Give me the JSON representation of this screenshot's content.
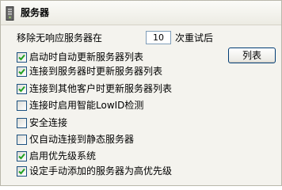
{
  "header": {
    "title": "服务器",
    "icon": "server-icon"
  },
  "retry": {
    "label": "移除无响应服务器在",
    "value": "10",
    "suffix": "次重试后"
  },
  "list_button": {
    "label": "列表"
  },
  "options": [
    {
      "label": "启动时自动更新服务器列表",
      "checked": true
    },
    {
      "label": "连接到服务器时更新服务器列表",
      "checked": true
    },
    {
      "label": "连接到其他客户时更新服务器列表",
      "checked": true
    },
    {
      "label": "连接时启用智能LowID检测",
      "checked": false
    },
    {
      "label": "安全连接",
      "checked": false
    },
    {
      "label": "仅自动连接到静态服务器",
      "checked": false
    },
    {
      "label": "启用优先级系统",
      "checked": true
    },
    {
      "label": "设定手动添加的服务器为高优先级",
      "checked": true
    }
  ],
  "colors": {
    "checkmark": "#21a121",
    "checkbox_border": "#1c5180",
    "panel_bg": "#f4f3ee"
  }
}
